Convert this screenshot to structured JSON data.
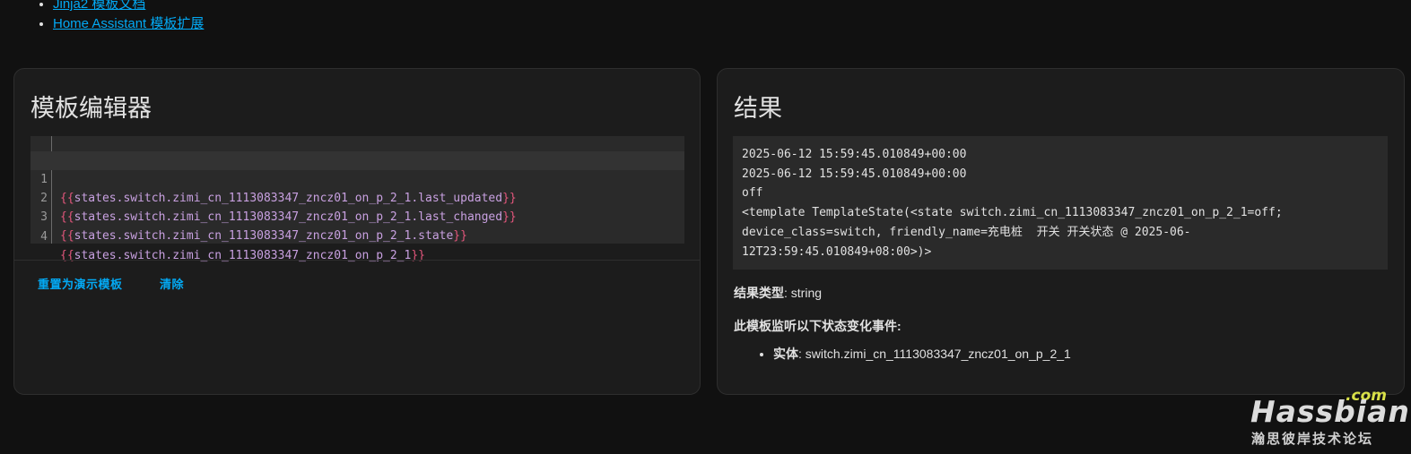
{
  "links": [
    {
      "label": "Jinja2 模板文档"
    },
    {
      "label": "Home Assistant 模板扩展"
    }
  ],
  "editor": {
    "title": "模板编辑器",
    "lines": [
      {
        "num": "1",
        "open": "{{",
        "body": "states.switch.zimi_cn_1113083347_zncz01_on_p_2_1.last_updated",
        "close": "}}"
      },
      {
        "num": "2",
        "open": "{{",
        "body": "states.switch.zimi_cn_1113083347_zncz01_on_p_2_1.last_changed",
        "close": "}}"
      },
      {
        "num": "3",
        "open": "{{",
        "body": "states.switch.zimi_cn_1113083347_zncz01_on_p_2_1.state",
        "close": "}}"
      },
      {
        "num": "4",
        "open": "{{",
        "body": "states.switch.zimi_cn_1113083347_zncz01_on_p_2_1",
        "close": "}}"
      }
    ],
    "reset_label": "重置为演示模板",
    "clear_label": "清除"
  },
  "result": {
    "title": "结果",
    "output_lines": [
      "2025-06-12 15:59:45.010849+00:00",
      "2025-06-12 15:59:45.010849+00:00",
      "off",
      "<template TemplateState(<state switch.zimi_cn_1113083347_zncz01_on_p_2_1=off;",
      "device_class=switch, friendly_name=充电桩  开关 开关状态 @ 2025-06-",
      "12T23:59:45.010849+08:00>)>"
    ],
    "type_label": "结果类型",
    "type_value": "string",
    "listen_label": "此模板监听以下状态变化事件:",
    "entity_label": "实体",
    "entity_value": "switch.zimi_cn_1113083347_zncz01_on_p_2_1"
  },
  "watermark": {
    "com": ".com",
    "name": "Hassbian",
    "subtitle": "瀚思彼岸技术论坛"
  },
  "colors": {
    "link": "#03a9f4",
    "bracket": "#e3567c",
    "code_text": "#c8a0e0"
  }
}
